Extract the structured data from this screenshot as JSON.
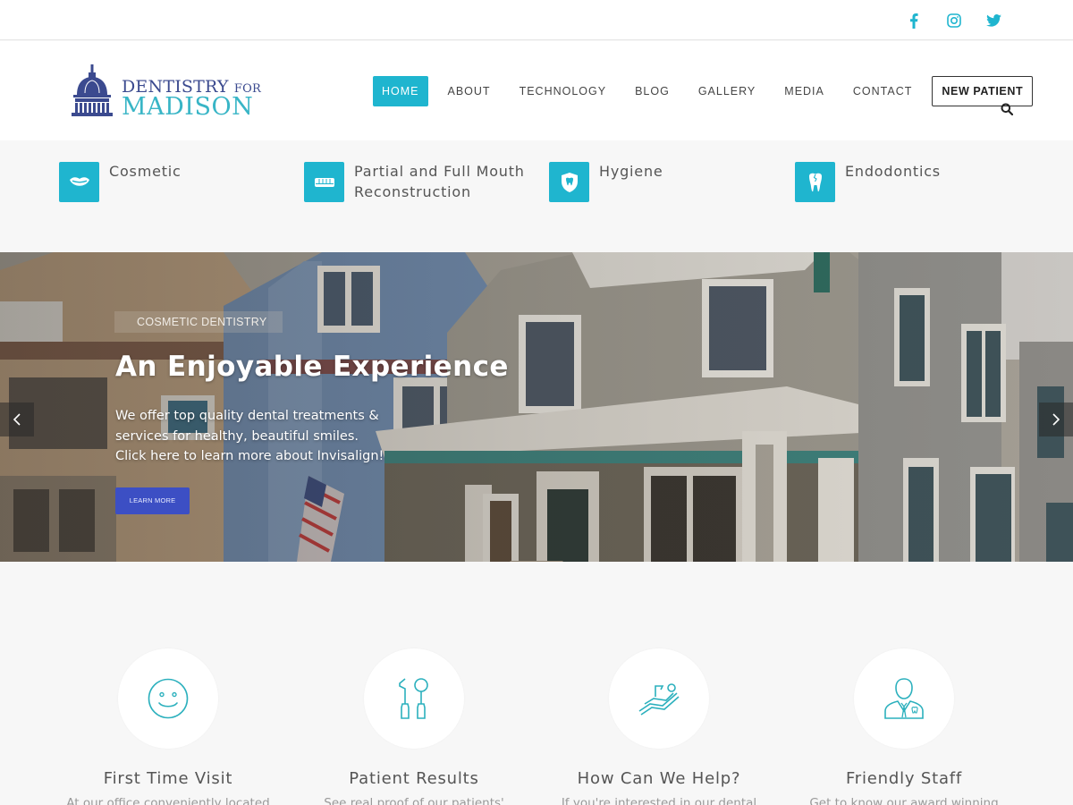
{
  "social": {
    "icons": [
      "facebook-icon",
      "instagram-icon",
      "twitter-icon"
    ],
    "color": "#1fb5cf"
  },
  "logo": {
    "line1_main": "DENTISTRY",
    "line1_small": "FOR",
    "line2": "MADISON",
    "primary_color": "#3b4a8f",
    "secondary_color": "#38b5c6"
  },
  "nav": {
    "items": [
      {
        "label": "HOME",
        "active": true
      },
      {
        "label": "ABOUT"
      },
      {
        "label": "TECHNOLOGY"
      },
      {
        "label": "BLOG"
      },
      {
        "label": "GALLERY"
      },
      {
        "label": "MEDIA"
      },
      {
        "label": "CONTACT"
      }
    ],
    "cta_label": "NEW PATIENT",
    "search_icon": "search-icon",
    "accent": "#1fb5cf"
  },
  "services": [
    {
      "label": "Cosmetic",
      "icon": "lips-icon"
    },
    {
      "label": "Partial and Full Mouth Reconstruction",
      "icon": "teeth-row-icon"
    },
    {
      "label": "Hygiene",
      "icon": "tooth-shield-icon"
    },
    {
      "label": "Endodontics",
      "icon": "cracked-tooth-icon"
    }
  ],
  "hero": {
    "tag": "COSMETIC DENTISTRY",
    "title": "An Enjoyable Experience",
    "text_line1": "We offer top quality dental treatments &",
    "text_line2": "services for healthy, beautiful smiles.",
    "text_line3": "Click here to learn more about Invisalign!",
    "button_label": "LEARN MORE",
    "button_color": "#3c4fc4",
    "prev_icon": "chevron-left-icon",
    "next_icon": "chevron-right-icon"
  },
  "features": [
    {
      "title": "First Time Visit",
      "text": "At our office conveniently located",
      "icon": "smiley-icon"
    },
    {
      "title": "Patient Results",
      "text": "See real proof of our patients'",
      "icon": "dental-tools-icon"
    },
    {
      "title": "How Can We Help?",
      "text": "If you're interested in our dental",
      "icon": "dental-chair-icon"
    },
    {
      "title": "Friendly Staff",
      "text": "Get to know our award winning",
      "icon": "dentist-staff-icon"
    }
  ]
}
